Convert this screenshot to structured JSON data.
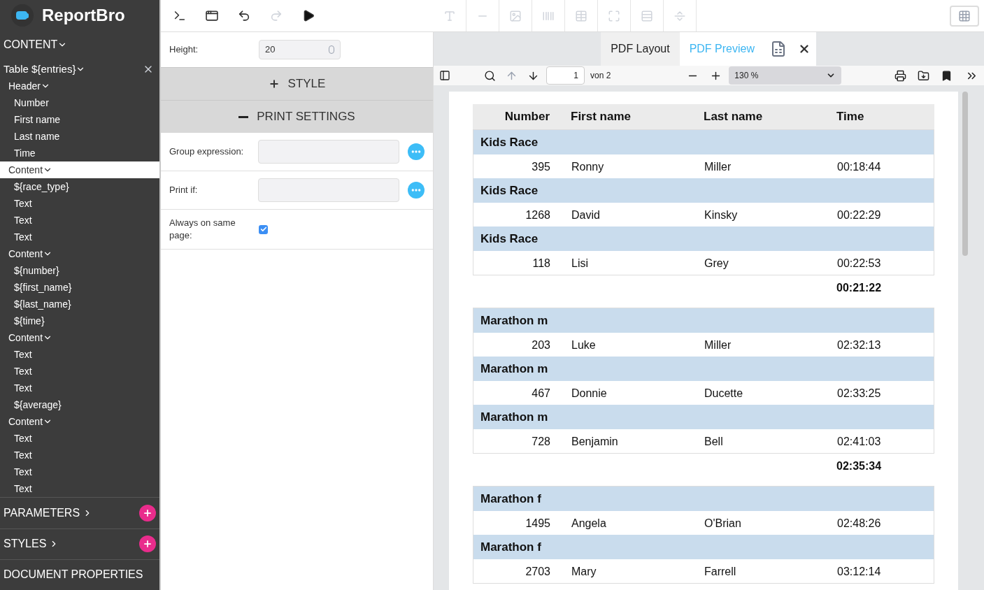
{
  "logo": {
    "name": "ReportBro"
  },
  "sidebar": {
    "content_title": "CONTENT",
    "tree": [
      {
        "label": "Table ${entries}",
        "expanded": true,
        "selected": false,
        "children": [
          {
            "label": "Header",
            "expanded": true,
            "selected": false,
            "children": [
              {
                "label": "Number"
              },
              {
                "label": "First name"
              },
              {
                "label": "Last name"
              },
              {
                "label": "Time"
              }
            ]
          },
          {
            "label": "Content",
            "expanded": true,
            "selected": true,
            "children": [
              {
                "label": "${race_type}"
              },
              {
                "label": "Text"
              },
              {
                "label": "Text"
              },
              {
                "label": "Text"
              }
            ]
          },
          {
            "label": "Content",
            "expanded": true,
            "selected": false,
            "children": [
              {
                "label": "${number}"
              },
              {
                "label": "${first_name}"
              },
              {
                "label": "${last_name}"
              },
              {
                "label": "${time}"
              }
            ]
          },
          {
            "label": "Content",
            "expanded": true,
            "selected": false,
            "children": [
              {
                "label": "Text"
              },
              {
                "label": "Text"
              },
              {
                "label": "Text"
              },
              {
                "label": "${average}"
              }
            ]
          },
          {
            "label": "Content",
            "expanded": true,
            "selected": false,
            "children": [
              {
                "label": "Text"
              },
              {
                "label": "Text"
              },
              {
                "label": "Text"
              },
              {
                "label": "Text"
              }
            ]
          }
        ]
      }
    ],
    "sections": [
      {
        "label": "PARAMETERS",
        "addable": true
      },
      {
        "label": "STYLES",
        "addable": true
      },
      {
        "label": "DOCUMENT PROPERTIES",
        "addable": false
      }
    ]
  },
  "properties": {
    "height": {
      "label": "Height:",
      "value": "20"
    },
    "style_section": {
      "label": "STYLE",
      "expanded": false
    },
    "print_section": {
      "label": "PRINT SETTINGS",
      "expanded": true
    },
    "fields": [
      {
        "kind": "expression",
        "label": "Group expression:"
      },
      {
        "kind": "expression",
        "label": "Print if:"
      },
      {
        "kind": "checkbox",
        "label": "Always on same page:",
        "checked": true
      }
    ]
  },
  "tabs": [
    {
      "label": "PDF Layout",
      "selected": false
    },
    {
      "label": "PDF Preview",
      "selected": true
    }
  ],
  "viewer": {
    "page": "1",
    "page_count": "von 2",
    "zoom": "130 %"
  },
  "report": {
    "columns": [
      "Number",
      "First name",
      "Last name",
      "Time"
    ],
    "groups": [
      {
        "rows": [
          {
            "kind": "group",
            "title": "Kids Race"
          },
          {
            "kind": "data",
            "cells": [
              "395",
              "Ronny",
              "Miller",
              "00:18:44"
            ]
          },
          {
            "kind": "group",
            "title": "Kids Race"
          },
          {
            "kind": "data",
            "cells": [
              "1268",
              "David",
              "Kinsky",
              "00:22:29"
            ]
          },
          {
            "kind": "group",
            "title": "Kids Race"
          },
          {
            "kind": "data",
            "cells": [
              "118",
              "Lisi",
              "Grey",
              "00:22:53"
            ]
          }
        ],
        "average": "00:21:22"
      },
      {
        "rows": [
          {
            "kind": "group",
            "title": "Marathon m"
          },
          {
            "kind": "data",
            "cells": [
              "203",
              "Luke",
              "Miller",
              "02:32:13"
            ]
          },
          {
            "kind": "group",
            "title": "Marathon m"
          },
          {
            "kind": "data",
            "cells": [
              "467",
              "Donnie",
              "Ducette",
              "02:33:25"
            ]
          },
          {
            "kind": "group",
            "title": "Marathon m"
          },
          {
            "kind": "data",
            "cells": [
              "728",
              "Benjamin",
              "Bell",
              "02:41:03"
            ]
          }
        ],
        "average": "02:35:34"
      },
      {
        "rows": [
          {
            "kind": "group",
            "title": "Marathon f"
          },
          {
            "kind": "data",
            "cells": [
              "1495",
              "Angela",
              "O'Brian",
              "02:48:26"
            ]
          },
          {
            "kind": "group",
            "title": "Marathon f"
          },
          {
            "kind": "data",
            "cells": [
              "2703",
              "Mary",
              "Farrell",
              "03:12:14"
            ]
          }
        ]
      }
    ]
  }
}
